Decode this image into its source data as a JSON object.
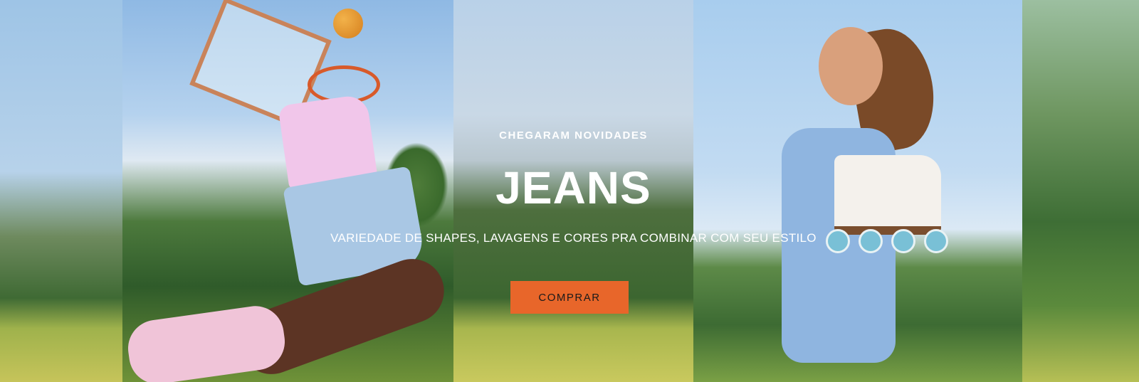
{
  "banner": {
    "eyebrow": "CHEGARAM NOVIDADES",
    "headline": "JEANS",
    "subtitle": "VARIEDADE DE SHAPES, LAVAGENS E CORES PRA COMBINAR COM SEU ESTILO",
    "cta_label": "COMPRAR",
    "colors": {
      "cta": "#e8662a",
      "text": "#ffffff"
    }
  }
}
